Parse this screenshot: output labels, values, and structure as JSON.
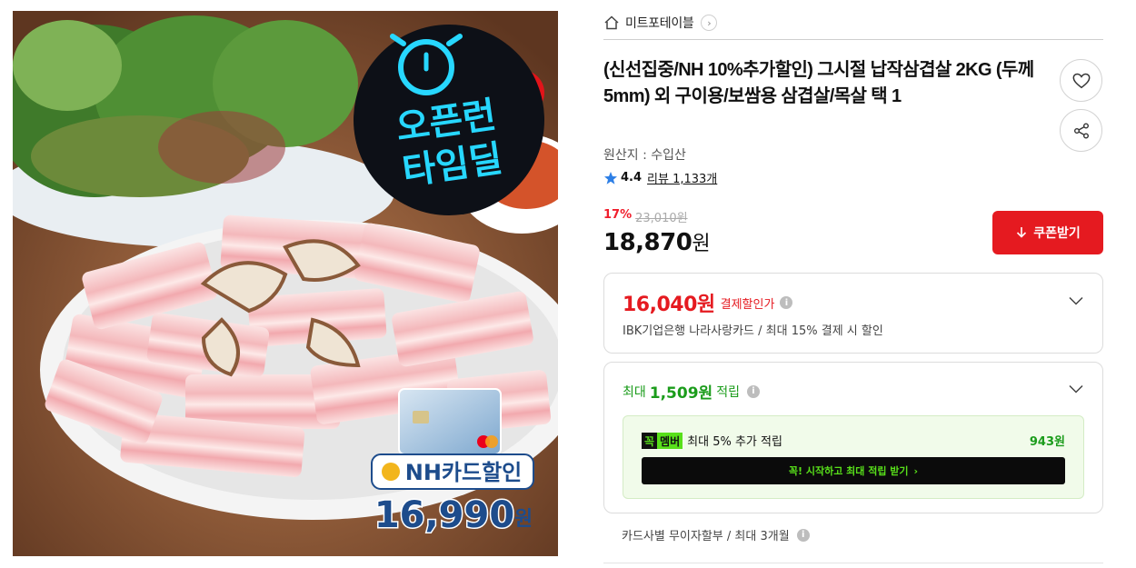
{
  "store": {
    "name": "미트포테이블",
    "icon": "home-icon"
  },
  "product": {
    "title": "(신선집중/NH 10%추가할인) 그시절 납작삼겹살 2KG (두께 5mm) 외 구이용/보쌈용 삼겹살/목살 택 1",
    "origin": "원산지 : 수입산",
    "rating": "4.4",
    "review_label": "리뷰 1,133개"
  },
  "image_badges": {
    "timedeal_line1": "오픈런",
    "timedeal_line2": "타임딜",
    "card_label": "NH카드할인",
    "card_price": "16,990",
    "card_price_unit": "원"
  },
  "price": {
    "discount_rate": "17%",
    "original": "23,010원",
    "sale": "18,870",
    "sale_unit": "원"
  },
  "coupon_button": {
    "label": "쿠폰받기"
  },
  "payment_discount": {
    "price": "16,040원",
    "label": "결제할인가",
    "description": "IBK기업은행 나라사랑카드 / 최대 15% 결제 시 할인"
  },
  "reward": {
    "prefix": "최대",
    "amount": "1,509원",
    "suffix": "적립",
    "membership": {
      "logo_a": "꼭",
      "logo_b": "멤버",
      "text": "최대 5% 추가 적립",
      "points": "943원",
      "button_label": "꼭! 시작하고 최대 적립 받기"
    }
  },
  "installment": {
    "text": "카드사별 무이자할부 / 최대 3개월"
  },
  "colors": {
    "accent_red": "#e51a20",
    "reward_green": "#1b9c1b",
    "member_green": "#58e01a"
  }
}
